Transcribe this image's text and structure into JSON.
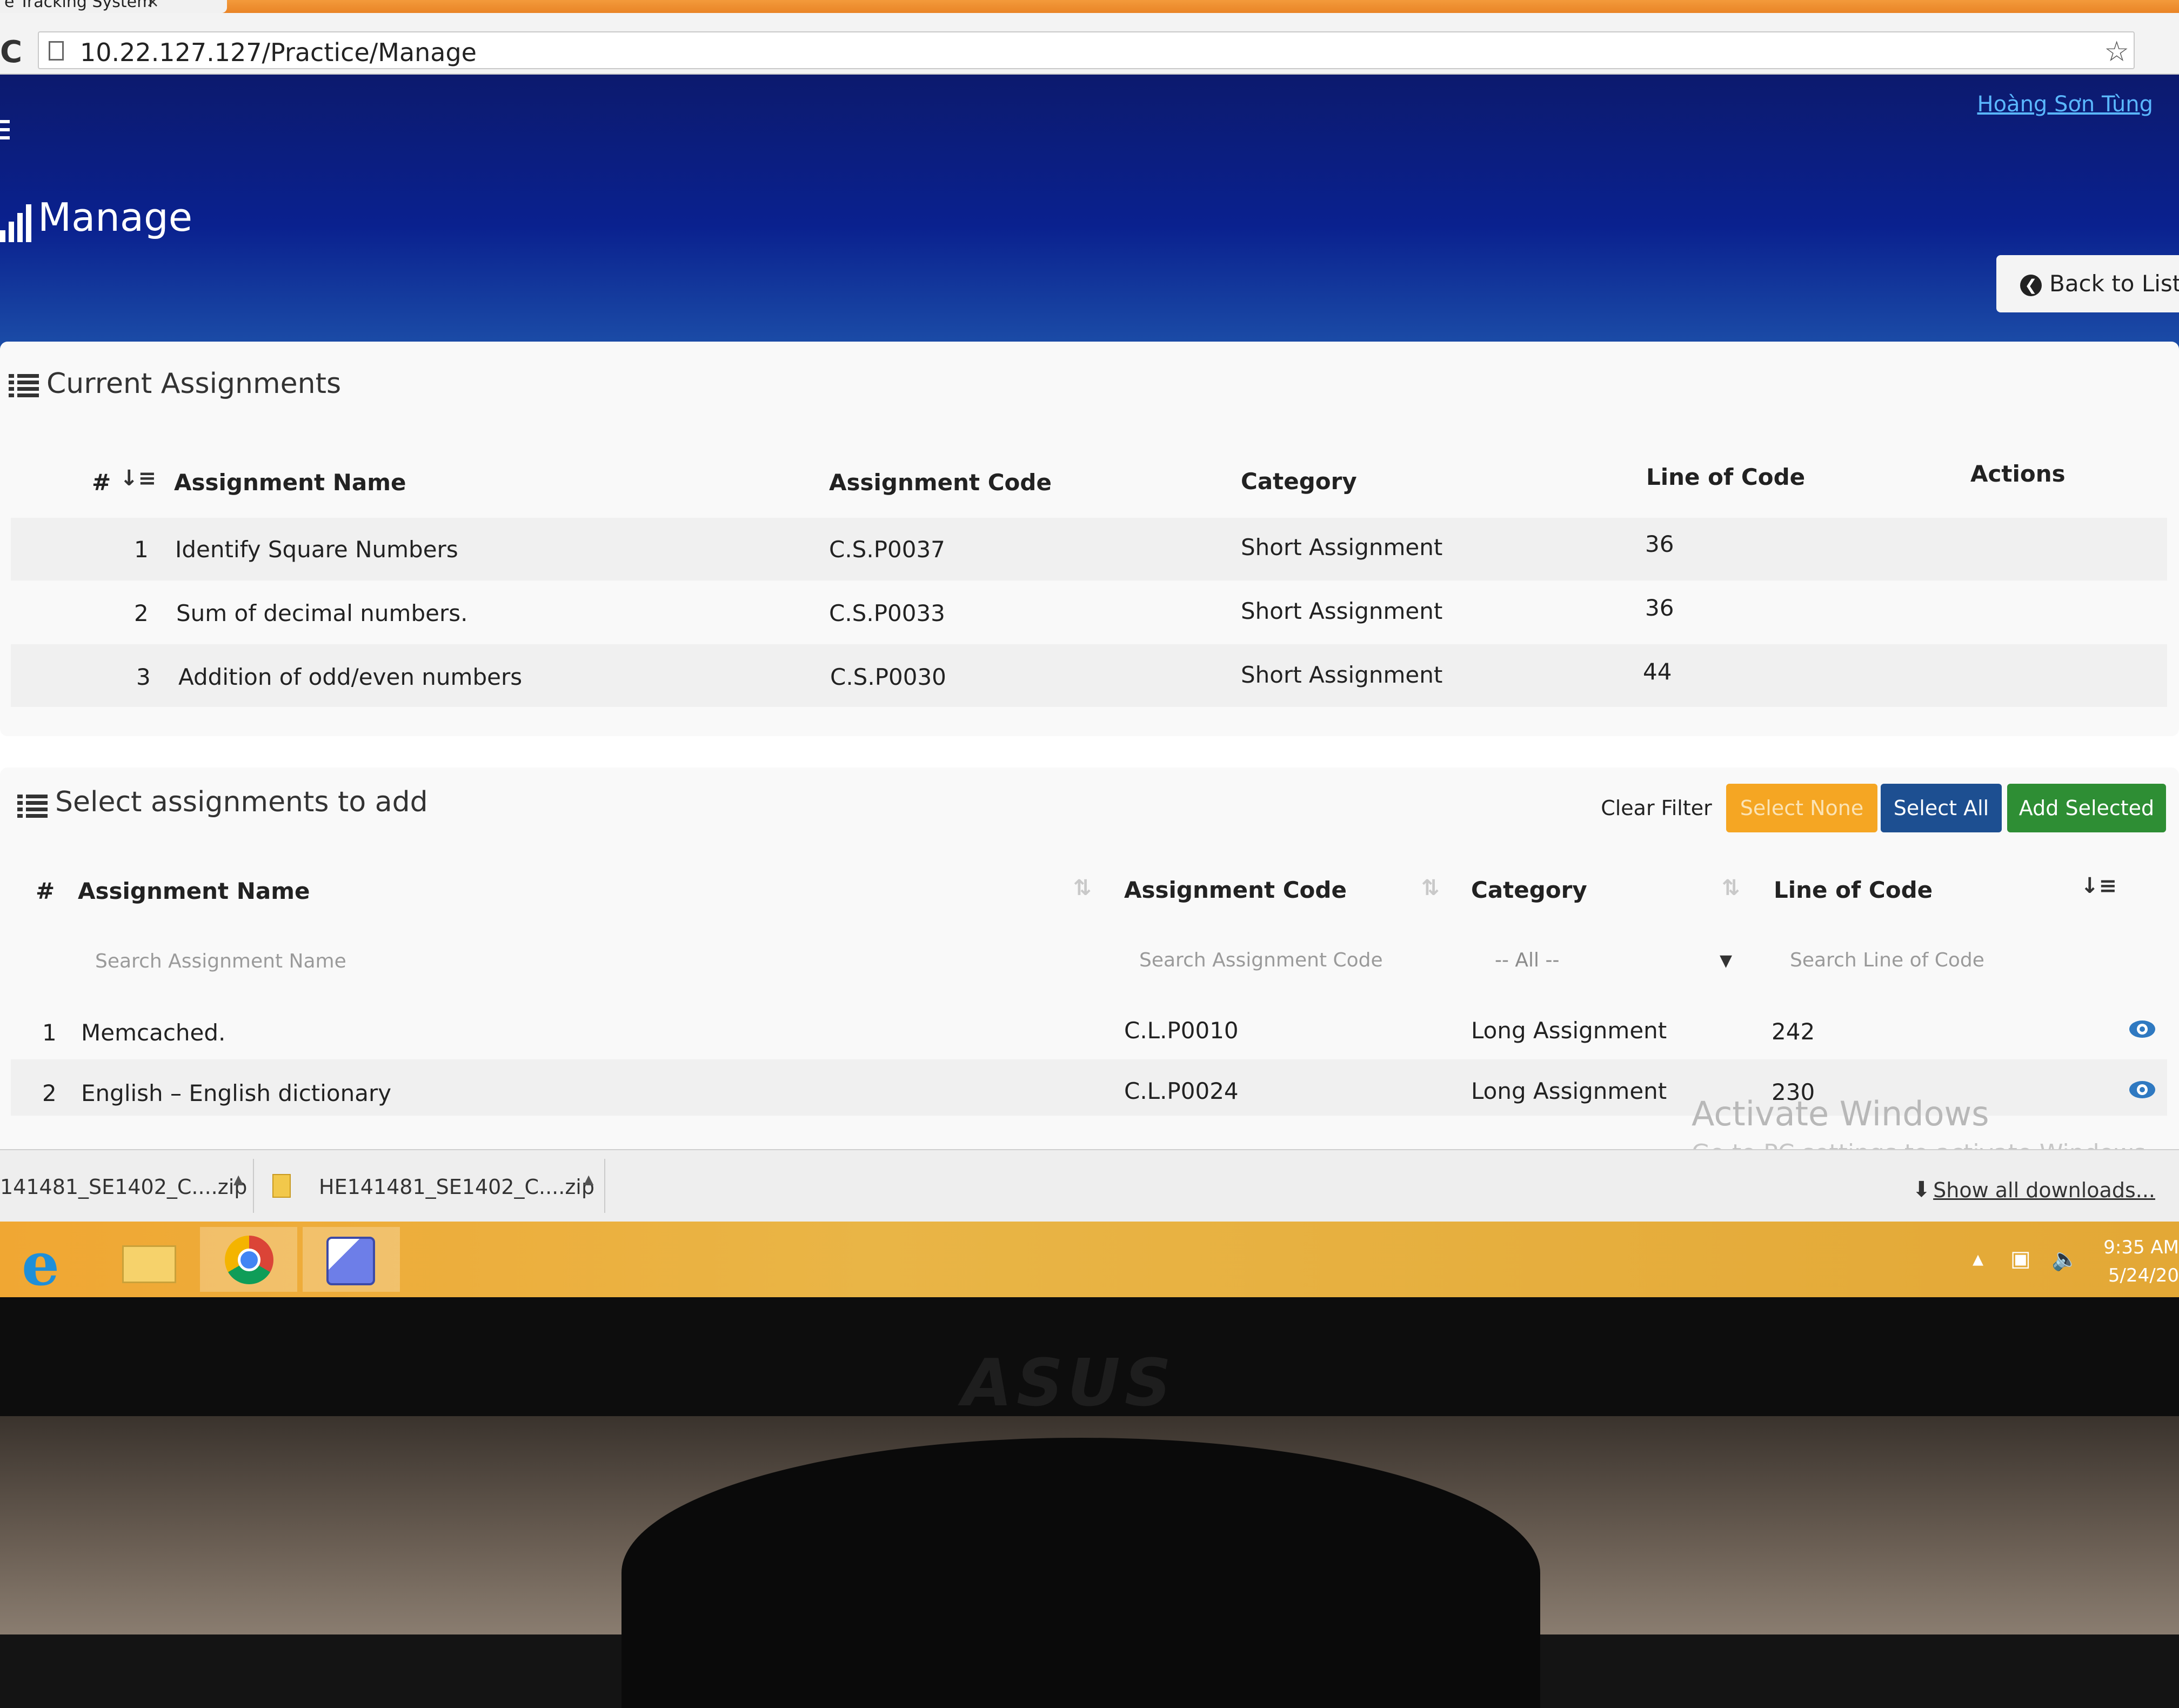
{
  "browser": {
    "tab_title": "e Tracking System",
    "tab_close": "×",
    "url": "10.22.127.127/Practice/Manage"
  },
  "header": {
    "user": "Hoàng Sơn Tùng",
    "title": "Manage",
    "back_button": "Back to List"
  },
  "current": {
    "title": "Current Assignments",
    "columns": [
      "#",
      "Assignment Name",
      "Assignment Code",
      "Category",
      "Line of Code",
      "Actions"
    ],
    "rows": [
      {
        "num": "1",
        "name": "Identify Square Numbers",
        "code": "C.S.P0037",
        "category": "Short Assignment",
        "loc": "36"
      },
      {
        "num": "2",
        "name": "Sum of decimal numbers.",
        "code": "C.S.P0033",
        "category": "Short Assignment",
        "loc": "36"
      },
      {
        "num": "3",
        "name": "Addition of odd/even numbers",
        "code": "C.S.P0030",
        "category": "Short Assignment",
        "loc": "44"
      }
    ]
  },
  "select": {
    "title": "Select assignments to add",
    "buttons": {
      "clear": "Clear Filter",
      "none": "Select None",
      "all": "Select All",
      "add": "Add Selected"
    },
    "columns": [
      "#",
      "Assignment Name",
      "Assignment Code",
      "Category",
      "Line of Code"
    ],
    "filters": {
      "name": "Search Assignment Name",
      "code": "Search Assignment Code",
      "category": "-- All --",
      "loc": "Search Line of Code"
    },
    "rows": [
      {
        "num": "1",
        "name": "Memcached.",
        "code": "C.L.P0010",
        "category": "Long Assignment",
        "loc": "242"
      },
      {
        "num": "2",
        "name": "English – English dictionary",
        "code": "C.L.P0024",
        "category": "Long Assignment",
        "loc": "230"
      }
    ]
  },
  "watermark": {
    "line1": "Activate Windows",
    "line2": "Go to PC settings to activate Windows."
  },
  "downloads": {
    "items": [
      "141481_SE1402_C....zip",
      "HE141481_SE1402_C....zip"
    ],
    "show_all": "Show all downloads..."
  },
  "taskbar": {
    "time": "9:35 AM",
    "date": "5/24/20"
  },
  "monitor_brand": "ASUS"
}
